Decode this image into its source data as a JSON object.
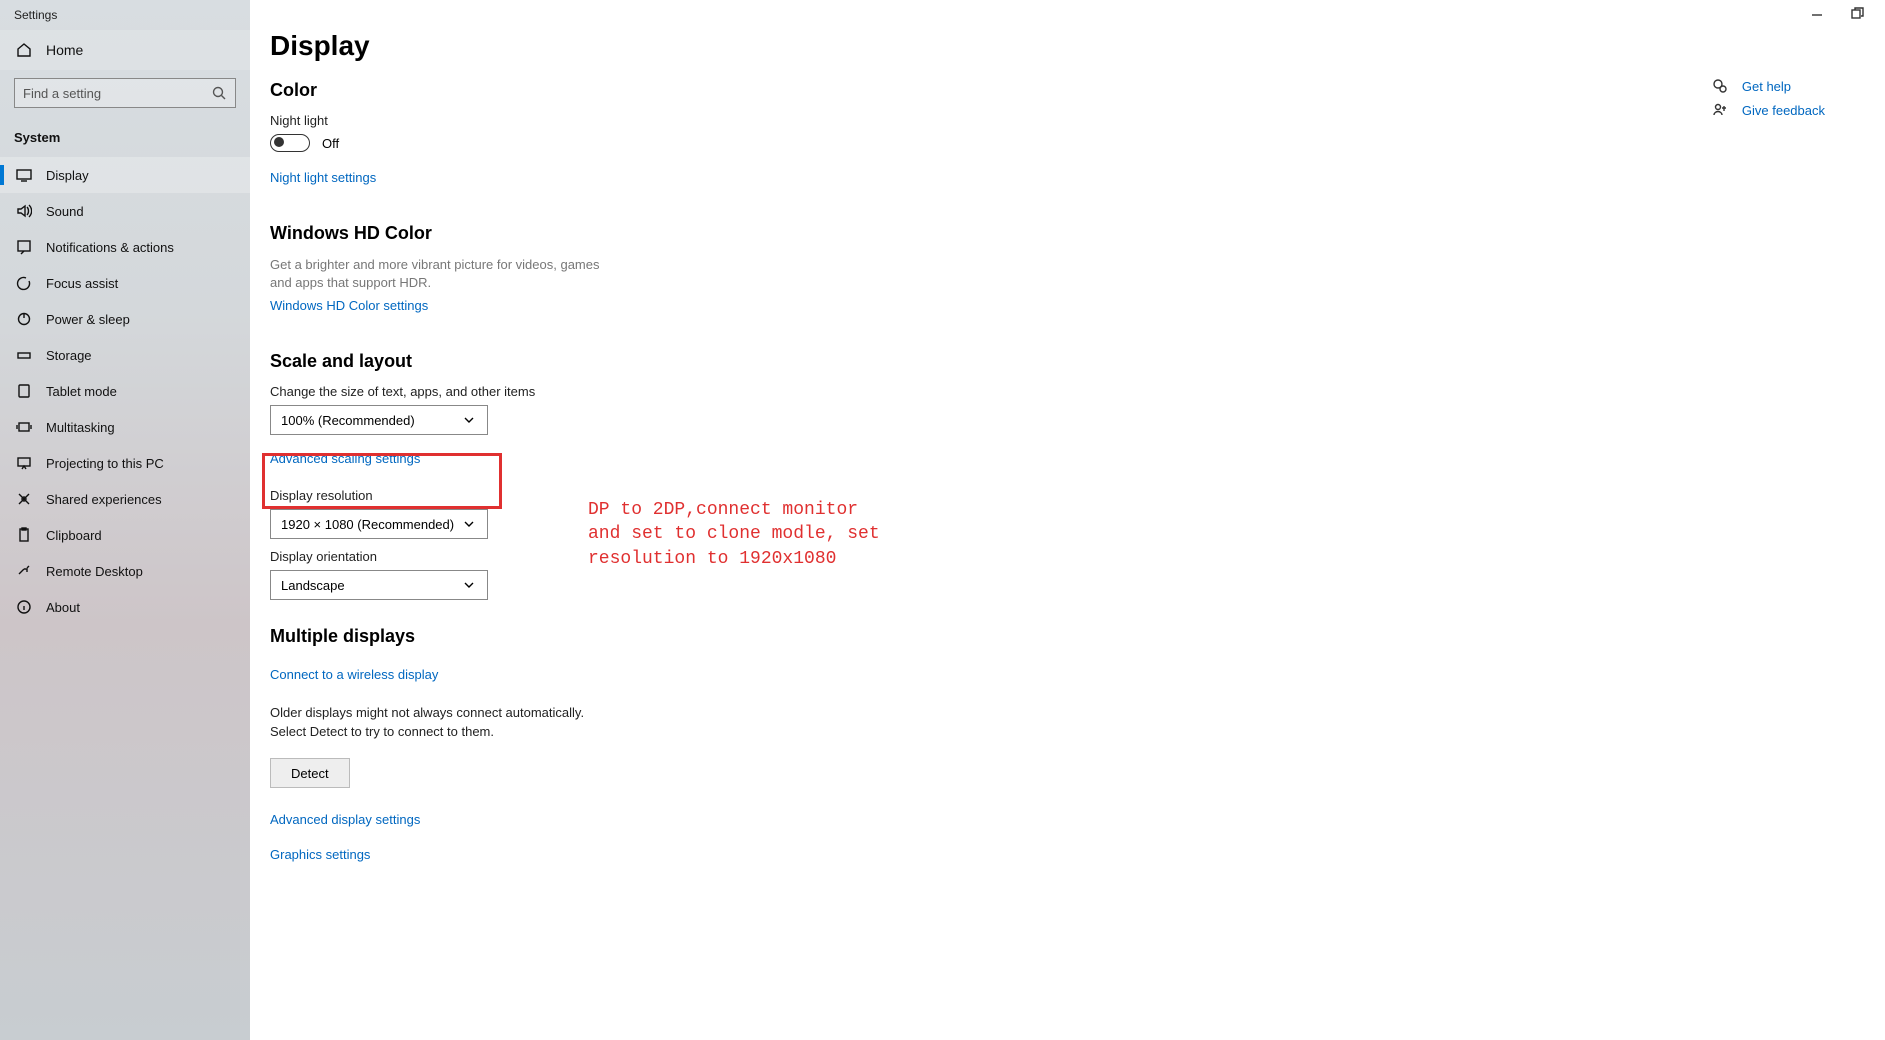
{
  "window": {
    "title": "Settings"
  },
  "sidebar": {
    "home": "Home",
    "search_placeholder": "Find a setting",
    "section": "System",
    "items": [
      {
        "label": "Display",
        "icon": "display-icon",
        "active": true
      },
      {
        "label": "Sound",
        "icon": "sound-icon"
      },
      {
        "label": "Notifications & actions",
        "icon": "notifications-icon"
      },
      {
        "label": "Focus assist",
        "icon": "focus-icon"
      },
      {
        "label": "Power & sleep",
        "icon": "power-icon"
      },
      {
        "label": "Storage",
        "icon": "storage-icon"
      },
      {
        "label": "Tablet mode",
        "icon": "tablet-icon"
      },
      {
        "label": "Multitasking",
        "icon": "multitasking-icon"
      },
      {
        "label": "Projecting to this PC",
        "icon": "projecting-icon"
      },
      {
        "label": "Shared experiences",
        "icon": "shared-icon"
      },
      {
        "label": "Clipboard",
        "icon": "clipboard-icon"
      },
      {
        "label": "Remote Desktop",
        "icon": "remote-icon"
      },
      {
        "label": "About",
        "icon": "about-icon"
      }
    ]
  },
  "page": {
    "title": "Display",
    "color": {
      "heading": "Color",
      "night_light_label": "Night light",
      "night_light_state": "Off",
      "night_light_link": "Night light settings"
    },
    "hd": {
      "heading": "Windows HD Color",
      "desc": "Get a brighter and more vibrant picture for videos, games and apps that support HDR.",
      "link": "Windows HD Color settings"
    },
    "scale": {
      "heading": "Scale and layout",
      "scale_label": "Change the size of text, apps, and other items",
      "scale_value": "100% (Recommended)",
      "scale_link": "Advanced scaling settings",
      "resolution_label": "Display resolution",
      "resolution_value": "1920 × 1080 (Recommended)",
      "orientation_label": "Display orientation",
      "orientation_value": "Landscape"
    },
    "multi": {
      "heading": "Multiple displays",
      "wireless_link": "Connect to a wireless display",
      "detect_desc": "Older displays might not always connect automatically. Select Detect to try to connect to them.",
      "detect_button": "Detect",
      "adv_link": "Advanced display settings",
      "graphics_link": "Graphics settings"
    }
  },
  "aside": {
    "help": "Get help",
    "feedback": "Give feedback"
  },
  "annotation": {
    "text": "DP to 2DP,connect monitor\nand set to clone modle, set\nresolution to 1920x1080"
  }
}
